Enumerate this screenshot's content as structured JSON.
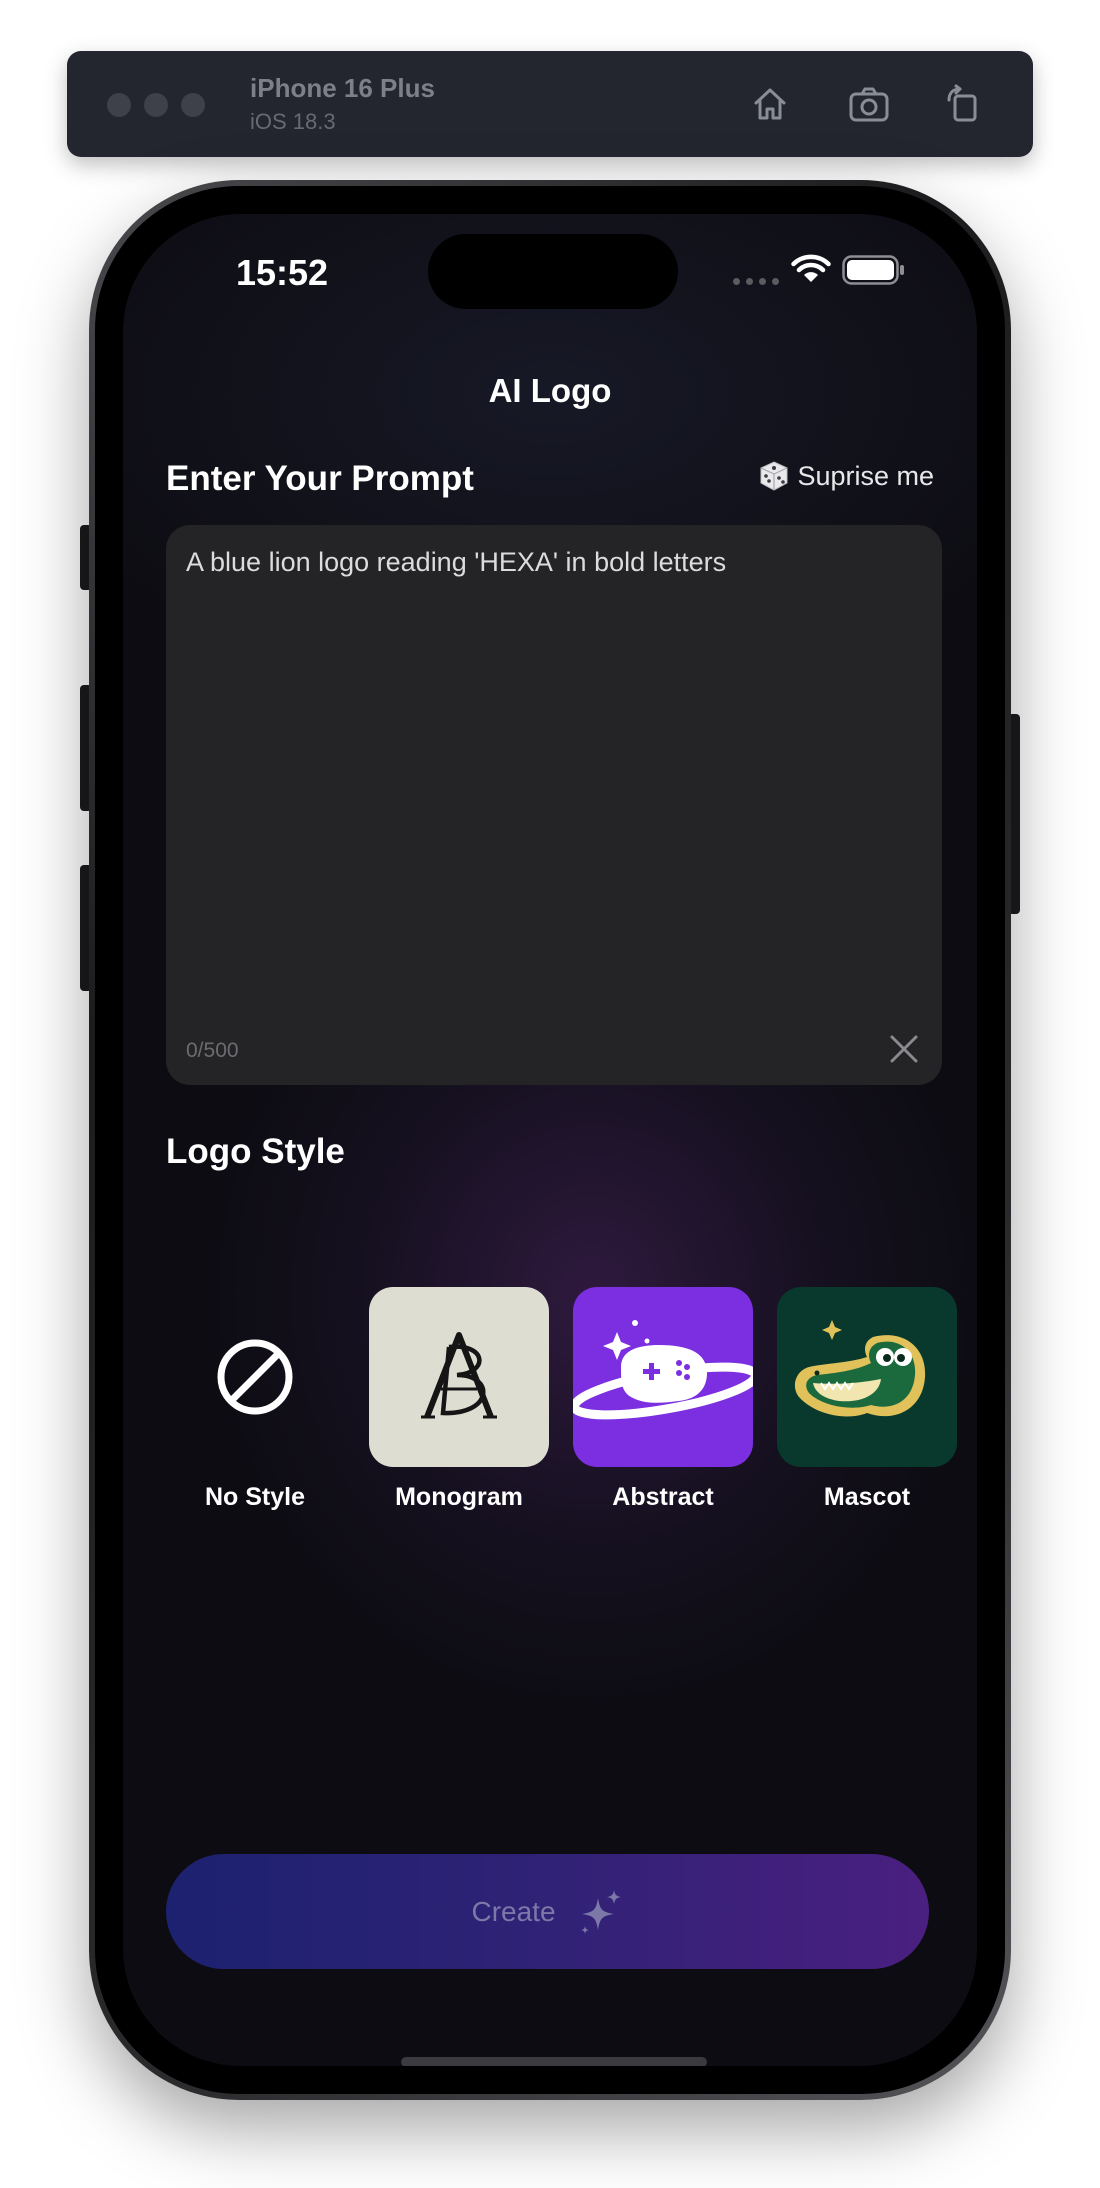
{
  "simulator": {
    "device_name": "iPhone 16 Plus",
    "os_version": "iOS 18.3",
    "buttons": [
      {
        "icon": "home-icon"
      },
      {
        "icon": "screenshot-icon"
      },
      {
        "icon": "rotate-icon"
      }
    ]
  },
  "status_bar": {
    "time": "15:52"
  },
  "app": {
    "title": "AI Logo",
    "prompt_section": {
      "title": "Enter Your Prompt",
      "surprise_label": "Suprise me",
      "prompt_value": "A blue lion logo reading 'HEXA' in bold letters",
      "char_count": "0/500"
    },
    "style_section": {
      "title": "Logo Style",
      "styles": [
        {
          "label": "No Style",
          "icon": "no-style-icon"
        },
        {
          "label": "Monogram",
          "icon": "monogram-thumbnail"
        },
        {
          "label": "Abstract",
          "icon": "abstract-planet-thumbnail"
        },
        {
          "label": "Mascot",
          "icon": "crocodile-mascot-thumbnail"
        }
      ]
    },
    "create_button": {
      "label": "Create",
      "icon": "sparkle-icon"
    }
  },
  "colors": {
    "screen_bg": "#0d0c12",
    "prompt_box_bg": "#242426",
    "monogram_bg": "#deddd2",
    "abstract_bg": "#7b2fe0",
    "mascot_bg": "#08392c",
    "create_gradient_start": "#1c2170",
    "create_gradient_end": "#4a1f80"
  }
}
